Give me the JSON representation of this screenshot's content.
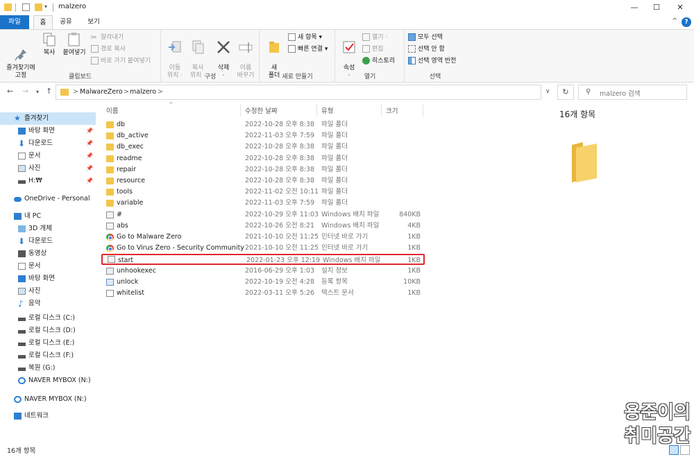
{
  "window": {
    "title": "malzero",
    "minimize": "—",
    "maximize": "☐",
    "close": "✕"
  },
  "ribbon_tabs": [
    {
      "label": "파일"
    },
    {
      "label": "홈"
    },
    {
      "label": "공유"
    },
    {
      "label": "보기"
    }
  ],
  "ribbon": {
    "clipboard": {
      "label": "클립보드",
      "pin": "즐겨찾기에\n고정",
      "copy": "복사",
      "paste": "붙여넣기",
      "cut": "잘라내기",
      "copy_path": "경로 복사",
      "paste_shortcut": "바로 가기 붙여넣기"
    },
    "organize": {
      "label": "구성",
      "move_to": "이동\n위치 ·",
      "copy_to": "복사\n위치 ·",
      "delete": "삭제\n·",
      "rename": "이름\n바꾸기"
    },
    "new": {
      "label": "새로 만들기",
      "new_folder": "새\n폴더",
      "new_item": "새 항목 ▾",
      "easy_access": "빠른 연결 ▾"
    },
    "open": {
      "label": "열기",
      "properties": "속성\n·",
      "open": "열기 ·",
      "edit": "편집",
      "history": "히스토리"
    },
    "select": {
      "label": "선택",
      "select_all": "모두 선택",
      "select_none": "선택 안 함",
      "invert": "선택 영역 반전"
    }
  },
  "address": {
    "crumbs": [
      "MalwareZero",
      "malzero"
    ],
    "separator": ">",
    "search_placeholder": "malzero 검색"
  },
  "nav_pane": {
    "quick_access": "즐겨찾기",
    "quick_items": [
      "바탕 화면",
      "다운로드",
      "문서",
      "사진",
      "H:₩"
    ],
    "onedrive": "OneDrive - Personal",
    "this_pc": "내 PC",
    "pc_items": [
      "3D 개체",
      "다운로드",
      "동영상",
      "문서",
      "바탕 화면",
      "사진",
      "음악",
      "로컬 디스크 (C:)",
      "로컬 디스크 (D:)",
      "로컬 디스크 (E:)",
      "로컬 디스크 (F:)",
      "복원 (G:)",
      "NAVER MYBOX (N:)"
    ],
    "naver": "NAVER MYBOX (N:)",
    "network": "네트워크"
  },
  "columns": {
    "name": "이름",
    "date": "수정한 날짜",
    "type": "유형",
    "size": "크기"
  },
  "files": [
    {
      "name": "db",
      "date": "2022-10-28 오후 8:38",
      "type": "파일 폴더",
      "size": "",
      "icon": "folder"
    },
    {
      "name": "db_active",
      "date": "2022-11-03 오후 7:59",
      "type": "파일 폴더",
      "size": "",
      "icon": "folder"
    },
    {
      "name": "db_exec",
      "date": "2022-10-28 오후 8:38",
      "type": "파일 폴더",
      "size": "",
      "icon": "folder"
    },
    {
      "name": "readme",
      "date": "2022-10-28 오후 8:38",
      "type": "파일 폴더",
      "size": "",
      "icon": "folder"
    },
    {
      "name": "repair",
      "date": "2022-10-28 오후 8:38",
      "type": "파일 폴더",
      "size": "",
      "icon": "folder"
    },
    {
      "name": "resource",
      "date": "2022-10-28 오후 8:38",
      "type": "파일 폴더",
      "size": "",
      "icon": "folder"
    },
    {
      "name": "tools",
      "date": "2022-11-02 오전 10:11",
      "type": "파일 폴더",
      "size": "",
      "icon": "folder"
    },
    {
      "name": "variable",
      "date": "2022-11-03 오후 7:59",
      "type": "파일 폴더",
      "size": "",
      "icon": "folder"
    },
    {
      "name": "#",
      "date": "2022-10-29 오후 11:03",
      "type": "Windows 배치 파일",
      "size": "840KB",
      "icon": "bat"
    },
    {
      "name": "abs",
      "date": "2022-10-26 오전 8:21",
      "type": "Windows 배치 파일",
      "size": "4KB",
      "icon": "bat"
    },
    {
      "name": "Go to Malware Zero",
      "date": "2021-10-10 오전 11:25",
      "type": "인터넷 바로 가기",
      "size": "1KB",
      "icon": "chrome"
    },
    {
      "name": "Go to Virus Zero - Security Community",
      "date": "2021-10-10 오전 11:25",
      "type": "인터넷 바로 가기",
      "size": "1KB",
      "icon": "chrome"
    },
    {
      "name": "start",
      "date": "2022-01-23 오후 12:19",
      "type": "Windows 배치 파일",
      "size": "1KB",
      "icon": "bat",
      "highlight": true
    },
    {
      "name": "unhookexec",
      "date": "2016-06-29 오후 1:03",
      "type": "설치 정보",
      "size": "1KB",
      "icon": "setup"
    },
    {
      "name": "unlock",
      "date": "2022-10-19 오전 4:28",
      "type": "등록 항목",
      "size": "10KB",
      "icon": "reg"
    },
    {
      "name": "whitelist",
      "date": "2022-03-11 오후 5:26",
      "type": "텍스트 문서",
      "size": "1KB",
      "icon": "txt"
    }
  ],
  "details": {
    "count": "16개 항목"
  },
  "status": {
    "count": "16개 항목"
  },
  "watermark": {
    "line1": "용준이의",
    "line2": "취미공간"
  },
  "colors": {
    "accent": "#1a73c8",
    "folder": "#f5c54a",
    "highlight_border": "#e0262d",
    "selected_nav": "#cce4f7"
  }
}
